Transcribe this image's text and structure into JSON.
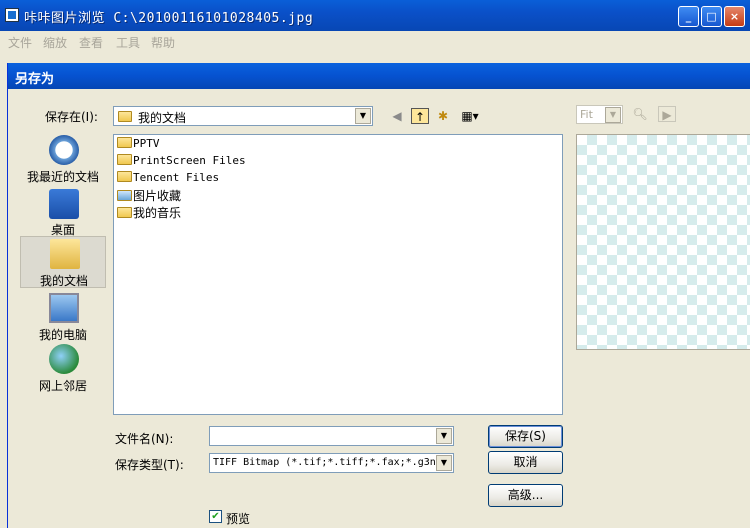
{
  "app": {
    "title": "咔咔图片浏览 C:\\20100116101028405.jpg",
    "minimize": "_",
    "maximize": "□",
    "close": "×"
  },
  "menu": [
    "文件",
    "缩放",
    "查看",
    "工具",
    "帮助"
  ],
  "dialog": {
    "title": "另存为",
    "save_in_label": "保存在(I):",
    "save_in_value": "我的文档",
    "places": [
      {
        "label": "我最近的文档",
        "icon": "recent-documents-icon"
      },
      {
        "label": "桌面",
        "icon": "desktop-icon"
      },
      {
        "label": "我的文档",
        "icon": "my-documents-icon"
      },
      {
        "label": "我的电脑",
        "icon": "my-computer-icon"
      },
      {
        "label": "网上邻居",
        "icon": "network-places-icon"
      }
    ],
    "files": [
      {
        "name": "PPTV",
        "icon": "folder-icon"
      },
      {
        "name": "PrintScreen Files",
        "icon": "folder-icon"
      },
      {
        "name": "Tencent Files",
        "icon": "folder-icon"
      },
      {
        "name": "图片收藏",
        "icon": "pictures-folder-icon"
      },
      {
        "name": "我的音乐",
        "icon": "music-folder-icon"
      }
    ],
    "filename_label": "文件名(N):",
    "filename_value": "",
    "filetype_label": "保存类型(T):",
    "filetype_value": "TIFF Bitmap (*.tif;*.tiff;*.fax;*.g3n",
    "save_button": "保存(S)",
    "cancel_button": "取消",
    "advanced_button": "高级...",
    "preview_checkbox": "预览",
    "preview_checked": true,
    "zoom_value": "Fit"
  }
}
